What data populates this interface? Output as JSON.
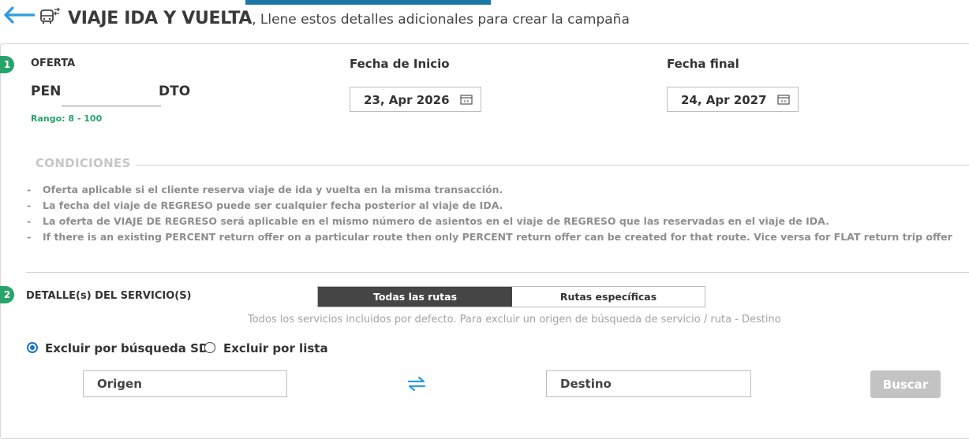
{
  "header": {
    "title": "VIAJE IDA Y VUELTA",
    "subtitle": ", Llene estos detalles adicionales para crear la campaña"
  },
  "section1": {
    "step": "1",
    "oferta_label": "OFERTA",
    "currency": "PEN",
    "discount_value": "",
    "suffix": "DTO",
    "range": "Rango: 8 - 100",
    "start_date_label": "Fecha de Inicio",
    "start_date": "23, Apr 2026",
    "end_date_label": "Fecha final",
    "end_date": "24, Apr 2027"
  },
  "conditions": {
    "title": "CONDICIONES",
    "items": [
      "Oferta aplicable si el cliente reserva viaje de ida y vuelta en la misma transacción.",
      "La fecha del viaje de REGRESO puede ser cualquier fecha posterior al viaje de IDA.",
      "La oferta de VIAJE DE REGRESO será aplicable en el mismo número de asientos en el viaje de REGRESO que las reservadas en el viaje de IDA.",
      "If there is an existing PERCENT return offer on a particular route then only PERCENT return offer can be created for that route. Vice versa for FLAT return trip offer"
    ]
  },
  "section2": {
    "step": "2",
    "title": "DETALLE(s) DEL SERVICIO(S)",
    "tabs": [
      "Todas las rutas",
      "Rutas específicas"
    ],
    "hint": "Todos los servicios incluidos por defecto. Para excluir un origen de búsqueda de servicio / ruta - Destino",
    "radio_search": "Excluir por búsqueda SD",
    "radio_list": "Excluir por lista",
    "origin_placeholder": "Origen",
    "destination_placeholder": "Destino",
    "search_button": "Buscar"
  },
  "colors": {
    "accent": "#1b78a8",
    "step_green": "#27a36b",
    "back_arrow": "#2e9be0",
    "active_tab": "#454545",
    "disabled_button": "#c3c3c3"
  }
}
